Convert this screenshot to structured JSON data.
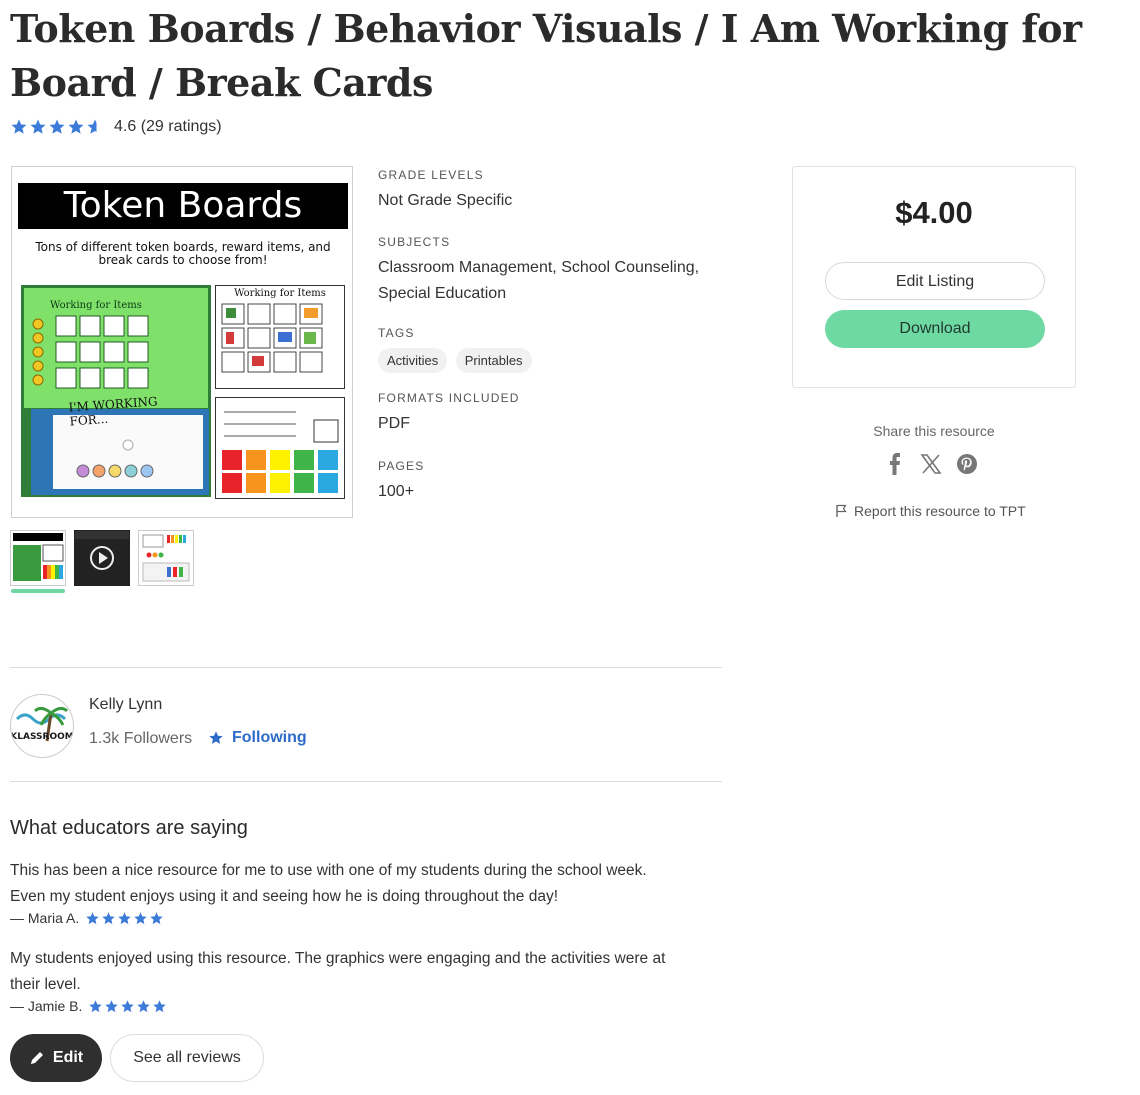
{
  "product": {
    "title": "Token Boards / Behavior Visuals / I Am Working for Board / Break Cards",
    "rating_value": 4.6,
    "rating_text": "4.6",
    "rating_count_text": "(29 ratings)"
  },
  "cover": {
    "heading": "Token Boards",
    "subheading": "Tons of different token boards, reward items, and break cards to choose from!",
    "photo_label": "Working for Items",
    "photo_caption": "I'M WORKING FOR...",
    "grid_label": "Working for Items"
  },
  "thumbnails": [
    {
      "name": "thumbnail-cover",
      "active": true
    },
    {
      "name": "thumbnail-video",
      "active": false
    },
    {
      "name": "thumbnail-preview",
      "active": false
    }
  ],
  "meta": {
    "grade_levels_label": "GRADE LEVELS",
    "grade_levels_value": "Not Grade Specific",
    "subjects_label": "SUBJECTS",
    "subjects_value_line1": "Classroom Management, School Counseling,",
    "subjects_value_line2": "Special Education",
    "tags_label": "TAGS",
    "tags": [
      "Activities",
      "Printables"
    ],
    "formats_label": "FORMATS INCLUDED",
    "formats_value": "PDF",
    "pages_label": "PAGES",
    "pages_value": "100+"
  },
  "purchase": {
    "price": "$4.00",
    "edit_listing_label": "Edit Listing",
    "download_label": "Download"
  },
  "share": {
    "label": "Share this resource",
    "icons": [
      "facebook-icon",
      "x-icon",
      "pinterest-icon"
    ],
    "report_label": "Report this resource to TPT"
  },
  "seller": {
    "name": "Kelly Lynn",
    "followers": "1.3k Followers",
    "following_label": "Following",
    "avatar_text": "KLASSROOM"
  },
  "reviews": {
    "heading": "What educators are saying",
    "items": [
      {
        "line1": "This has been a nice resource for me to use with one of my students during the school week.",
        "line2": "Even my student enjoys using it and seeing how he is doing throughout the day!",
        "author": "— Maria A.",
        "stars": 5
      },
      {
        "line1": "My students enjoyed using this resource. The graphics were engaging and the activities were at",
        "line2": "their level.",
        "author": "— Jamie B.",
        "stars": 5
      }
    ],
    "edit_label": "Edit",
    "see_all_label": "See all reviews"
  },
  "colors": {
    "star_blue": "#3d7bd9",
    "download_green": "#6fd9a4",
    "following_blue": "#2d6bc9",
    "edit_dark": "#2f2f2f"
  }
}
